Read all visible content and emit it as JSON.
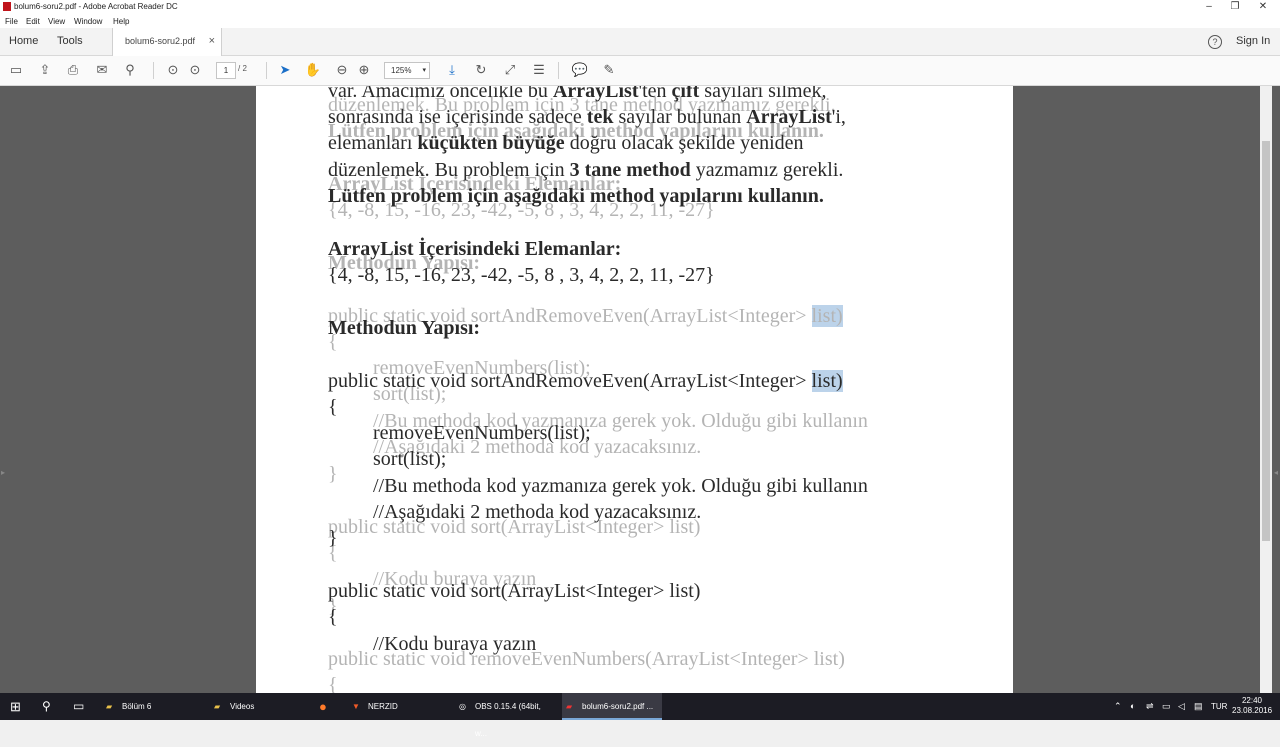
{
  "window": {
    "title": "bolum6-soru2.pdf - Adobe Acrobat Reader DC",
    "min": "–",
    "restore": "❐",
    "close": "✕"
  },
  "menu": [
    "File",
    "Edit",
    "View",
    "Window",
    "Help"
  ],
  "tabs": {
    "home": "Home",
    "tools": "Tools",
    "document": "bolum6-soru2.pdf",
    "close": "×"
  },
  "header": {
    "help": "?",
    "signin": "Sign In"
  },
  "toolbar": {
    "page_current": "1",
    "page_total": "/ 2",
    "zoom": "125%",
    "zoom_caret": "▾",
    "icons": [
      "save-icon",
      "upload-icon",
      "print-icon",
      "email-icon",
      "search-icon",
      "prev-page-icon",
      "next-page-icon",
      "select-cursor-icon",
      "hand-icon",
      "zoom-out-icon",
      "zoom-in-icon",
      "fit-page-icon",
      "rotate-icon",
      "full-screen-icon",
      "read-mode-icon",
      "comment-icon",
      "pen-icon"
    ]
  },
  "document": {
    "ghost": {
      "l1": "düzenlemek. Bu problem için 3 tane method yazmamız gerekli.",
      "l2": "Lütfen problem için aşağıdaki method yapılarını kullanın.",
      "l3": "ArrayList İçerisindeki Elemanlar:",
      "l4": "{4, -8, 15, -16, 23, -42, -5, 8 , 3, 4, 2, 2, 11, -27}",
      "l5": "Methodun Yapısı:",
      "l6a": "public static void sortAndRemoveEven(ArrayList<Integer> ",
      "l6b": "list)",
      "l7": "{",
      "l8": "removeEvenNumbers(list);",
      "l9": "sort(list);",
      "l10": "//Bu methoda kod yazmanıza gerek yok. Olduğu gibi kullanın",
      "l11": "//Aşağıdaki 2 methoda kod yazacaksınız.",
      "l12": "}",
      "l13": "public static void sort(ArrayList<Integer> list)",
      "l14": "{",
      "l15": "//Kodu buraya yazın",
      "l16": "}",
      "l17": "public static void removeEvenNumbers(ArrayList<Integer> list)",
      "l18": "{"
    },
    "real": {
      "r1a": "var. Amacımız öncelikle bu ",
      "r1b": "ArrayList",
      "r1c": "'ten ",
      "r1d": "çift",
      "r1e": " sayıları silmek,",
      "r2a": "sonrasında ise içerisinde sadece ",
      "r2b": "tek",
      "r2c": " sayılar bulunan ",
      "r2d": "ArrayList",
      "r2e": "'i,",
      "r3a": "elemanları ",
      "r3b": "küçükten büyüğe",
      "r3c": " doğru olacak şekilde yeniden",
      "r4a": "düzenlemek. Bu problem için ",
      "r4b": "3 tane method",
      "r4c": " yazmamız gerekli.",
      "r5": "Lütfen problem için aşağıdaki method yapılarını kullanın.",
      "r6": "ArrayList İçerisindeki Elemanlar:",
      "r7": "{4, -8, 15, -16, 23, -42, -5, 8 , 3, 4, 2, 2, 11, -27}",
      "r8": "Methodun Yapısı:",
      "r9a": "public static void sortAndRemoveEven(ArrayList<Integer> ",
      "r9b": "list)",
      "r10": "{",
      "r11": "removeEvenNumbers(list);",
      "r12": "sort(list);",
      "r13": "//Bu methoda kod yazmanıza gerek yok. Olduğu gibi kullanın",
      "r14": "//Aşağıdaki 2 methoda kod yazacaksınız.",
      "r15": "}",
      "r16": "public static void sort(ArrayList<Integer> list)",
      "r17": "{",
      "r18": "//Kodu buraya yazın"
    }
  },
  "taskbar": {
    "apps": [
      "Bölüm 6",
      "Videos",
      "NERZID",
      "OBS 0.15.4 (64bit, w...",
      "bolum6-soru2.pdf ..."
    ],
    "lang": "TUR",
    "time": "22:40",
    "date": "23.08.2016"
  }
}
